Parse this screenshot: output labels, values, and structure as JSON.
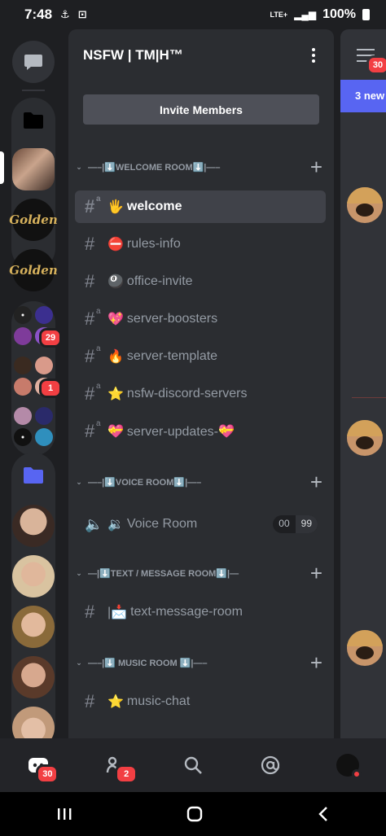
{
  "status_bar": {
    "time": "7:48",
    "network": "LTE+",
    "battery": "100%"
  },
  "rail": {
    "badges": {
      "group1": "29",
      "group2": "1"
    },
    "golden_label": "Golden"
  },
  "server": {
    "name": "NSFW | TM|H™",
    "invite_label": "Invite Members"
  },
  "categories": [
    {
      "label": "—–|⬇️WELCOME ROOM⬇️|—–"
    },
    {
      "label": "—–|⬇️VOICE ROOM⬇️|—–"
    },
    {
      "label": "—|⬇️TEXT / MESSAGE ROOM⬇️|—"
    },
    {
      "label": "—–|⬇️ MUSIC ROOM ⬇️|—–"
    }
  ],
  "channels": [
    {
      "emoji": "🖐️",
      "name": "welcome"
    },
    {
      "emoji": "⛔",
      "name": "rules-info"
    },
    {
      "emoji": "🎱",
      "name": "office-invite"
    },
    {
      "emoji": "💖",
      "name": "server-boosters"
    },
    {
      "emoji": "🔥",
      "name": "server-template"
    },
    {
      "emoji": "⭐",
      "name": "nsfw-discord-servers"
    },
    {
      "emoji": "💝",
      "name": "server-updates-💝"
    },
    {
      "emoji": "🔉",
      "name": "Voice Room",
      "count_current": "00",
      "count_limit": "99"
    },
    {
      "emoji": "|📩",
      "name": "text-message-room"
    },
    {
      "emoji": "⭐",
      "name": "music-chat"
    }
  ],
  "peek": {
    "banner": "3 new",
    "menu_badge": "30"
  },
  "bottom_nav": {
    "home_badge": "30",
    "friends_badge": "2"
  },
  "colors": {
    "background": "#1e1f22",
    "panel": "#2b2d31",
    "active_channel": "#404249",
    "badge": "#f23f43",
    "blurple": "#5865f2"
  }
}
